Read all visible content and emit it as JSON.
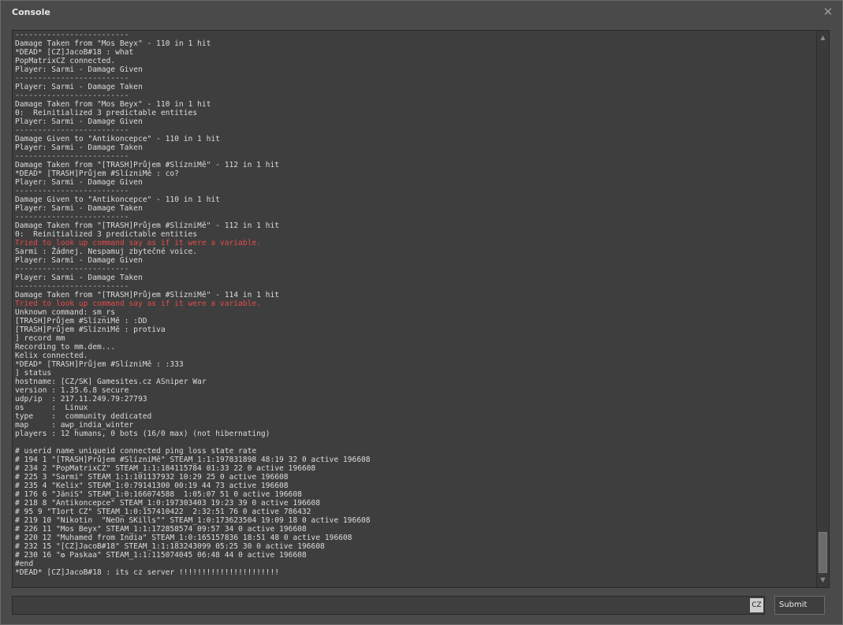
{
  "window": {
    "title": "Console",
    "close_glyph": "✕"
  },
  "console": {
    "lines": [
      {
        "text": "-------------------------",
        "kind": "sep"
      },
      {
        "text": "Damage Taken from \"Mos Beyx\" - 110 in 1 hit",
        "kind": "normal"
      },
      {
        "text": "*DEAD* [CZ]JacoB#18 : what",
        "kind": "normal"
      },
      {
        "text": "PopMatrixCZ connected.",
        "kind": "normal"
      },
      {
        "text": "Player: Sarmi - Damage Given",
        "kind": "normal"
      },
      {
        "text": "-------------------------",
        "kind": "sep"
      },
      {
        "text": "Player: Sarmi - Damage Taken",
        "kind": "normal"
      },
      {
        "text": "-------------------------",
        "kind": "sep"
      },
      {
        "text": "Damage Taken from \"Mos Beyx\" - 110 in 1 hit",
        "kind": "normal"
      },
      {
        "text": "0:  Reinitialized 3 predictable entities",
        "kind": "normal"
      },
      {
        "text": "Player: Sarmi - Damage Given",
        "kind": "normal"
      },
      {
        "text": "-------------------------",
        "kind": "sep"
      },
      {
        "text": "Damage Given to \"Antikoncepce\" - 110 in 1 hit",
        "kind": "normal"
      },
      {
        "text": "Player: Sarmi - Damage Taken",
        "kind": "normal"
      },
      {
        "text": "-------------------------",
        "kind": "sep"
      },
      {
        "text": "Damage Taken from \"[TRASH]Průjem #SlízniMě\" - 112 in 1 hit",
        "kind": "normal"
      },
      {
        "text": "*DEAD* [TRASH]Průjem #SlízniMě : co?",
        "kind": "normal"
      },
      {
        "text": "Player: Sarmi - Damage Given",
        "kind": "normal"
      },
      {
        "text": "-------------------------",
        "kind": "sep"
      },
      {
        "text": "Damage Given to \"Antikoncepce\" - 110 in 1 hit",
        "kind": "normal"
      },
      {
        "text": "Player: Sarmi - Damage Taken",
        "kind": "normal"
      },
      {
        "text": "-------------------------",
        "kind": "sep"
      },
      {
        "text": "Damage Taken from \"[TRASH]Průjem #SlízniMě\" - 112 in 1 hit",
        "kind": "normal"
      },
      {
        "text": "0:  Reinitialized 3 predictable entities",
        "kind": "normal"
      },
      {
        "text": "Tried to look up command say as if it were a variable.",
        "kind": "error"
      },
      {
        "text": "Sarmi : Žádnej. Nespamuj zbytečné voice.",
        "kind": "normal"
      },
      {
        "text": "Player: Sarmi - Damage Given",
        "kind": "normal"
      },
      {
        "text": "-------------------------",
        "kind": "sep"
      },
      {
        "text": "Player: Sarmi - Damage Taken",
        "kind": "normal"
      },
      {
        "text": "-------------------------",
        "kind": "sep"
      },
      {
        "text": "Damage Taken from \"[TRASH]Průjem #SlízniMě\" - 114 in 1 hit",
        "kind": "normal"
      },
      {
        "text": "Tried to look up command say as if it were a variable.",
        "kind": "error"
      },
      {
        "text": "Unknown command: sm_rs",
        "kind": "normal"
      },
      {
        "text": "[TRASH]Průjem #SlízniMě : :DD",
        "kind": "normal"
      },
      {
        "text": "[TRASH]Průjem #SlízniMě : protiva",
        "kind": "normal"
      },
      {
        "text": "] record mm",
        "kind": "normal"
      },
      {
        "text": "Recording to mm.dem...",
        "kind": "normal"
      },
      {
        "text": "Kelix connected.",
        "kind": "normal"
      },
      {
        "text": "*DEAD* [TRASH]Průjem #SlízniMě : :333",
        "kind": "normal"
      },
      {
        "text": "] status",
        "kind": "normal"
      },
      {
        "text": "hostname: [CZ/SK] Gamesites.cz ASniper War",
        "kind": "normal"
      },
      {
        "text": "version : 1.35.6.8 secure",
        "kind": "normal"
      },
      {
        "text": "udp/ip  : 217.11.249.79:27793",
        "kind": "normal"
      },
      {
        "text": "os      :  Linux",
        "kind": "normal"
      },
      {
        "text": "type    :  community dedicated",
        "kind": "normal"
      },
      {
        "text": "map     : awp_india_winter",
        "kind": "normal"
      },
      {
        "text": "players : 12 humans, 0 bots (16/0 max) (not hibernating)",
        "kind": "normal"
      },
      {
        "text": "",
        "kind": "normal"
      },
      {
        "text": "# userid name uniqueid connected ping loss state rate",
        "kind": "normal"
      },
      {
        "text": "# 194 1 \"[TRASH]Průjem #SlízniMě\" STEAM_1:1:197831898 48:19 32 0 active 196608",
        "kind": "normal"
      },
      {
        "text": "# 234 2 \"PopMatrixCZ\" STEAM_1:1:184115784 01:33 22 0 active 196608",
        "kind": "normal"
      },
      {
        "text": "# 225 3 \"Sarmi\" STEAM_1:1:101137932 10:29 25 0 active 196608",
        "kind": "normal"
      },
      {
        "text": "# 235 4 \"Kelix\" STEAM_1:0:79141300 00:19 44 73 active 196608",
        "kind": "normal"
      },
      {
        "text": "# 176 6 \"JäniS\" STEAM_1:0:166074588  1:05:07 51 0 active 196608",
        "kind": "normal"
      },
      {
        "text": "# 218 8 \"Antikoncepce\" STEAM_1:0:197303403 19:23 39 0 active 196608",
        "kind": "normal"
      },
      {
        "text": "# 95 9 \"T1ort CZ\" STEAM_1:0:157410422  2:32:51 76 0 active 786432",
        "kind": "normal"
      },
      {
        "text": "# 219 10 \"Nikotin  \"NeOn SKills\"\" STEAM_1:0:173623504 19:09 18 0 active 196608",
        "kind": "normal"
      },
      {
        "text": "# 226 11 \"Mos Beyx\" STEAM_1:1:172858574 09:57 34 0 active 196608",
        "kind": "normal"
      },
      {
        "text": "# 220 12 \"Muhamed from India\" STEAM_1:0:165157836 18:51 48 0 active 196608",
        "kind": "normal"
      },
      {
        "text": "# 232 15 \"[CZ]JacoB#18\" STEAM_1:1:183243099 05:25 30 0 active 196608",
        "kind": "normal"
      },
      {
        "text": "# 230 16 \"✪ Paskaa\" STEAM_1:1:115074045 06:48 44 0 active 196608",
        "kind": "normal"
      },
      {
        "text": "#end",
        "kind": "normal"
      },
      {
        "text": "*DEAD* [CZ]JacoB#18 : its cz server !!!!!!!!!!!!!!!!!!!!!!",
        "kind": "normal"
      }
    ],
    "scroll_up_glyph": "▲",
    "scroll_down_glyph": "▼"
  },
  "input": {
    "value": "",
    "placeholder": "",
    "language_badge": "CZ"
  },
  "submit": {
    "label": "Submit"
  },
  "colors": {
    "error_text": "#e34b4b",
    "normal_text": "#dcdcdc",
    "background": "#3e3e3e"
  }
}
